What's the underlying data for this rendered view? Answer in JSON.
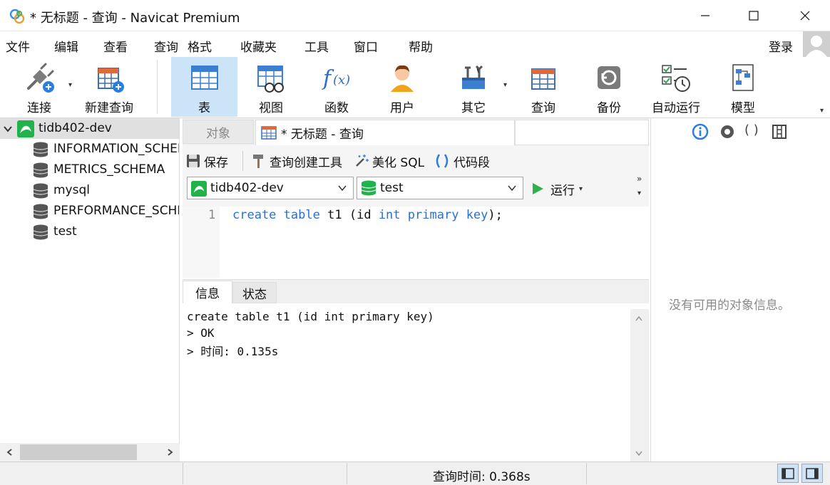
{
  "window": {
    "title": "* 无标题 - 查询 - Navicat Premium"
  },
  "menu": [
    "文件",
    "编辑",
    "查看",
    "查询",
    "格式",
    "收藏夹",
    "工具",
    "窗口",
    "帮助"
  ],
  "account": {
    "login_label": "登录"
  },
  "toolbar": {
    "connect": "连接",
    "new_query": "新建查询",
    "table": "表",
    "view": "视图",
    "function": "函数",
    "user": "用户",
    "other": "其它",
    "query": "查询",
    "backup": "备份",
    "automation": "自动运行",
    "model": "模型"
  },
  "tree": {
    "connection": "tidb402-dev",
    "databases": [
      "INFORMATION_SCHEMA",
      "METRICS_SCHEMA",
      "mysql",
      "PERFORMANCE_SCHEMA",
      "test"
    ]
  },
  "tabs": {
    "objects": "对象",
    "query": "* 无标题 - 查询"
  },
  "query_toolbar": {
    "save": "保存",
    "query_builder": "查询创建工具",
    "beautify": "美化 SQL",
    "snippet": "代码段",
    "connection_select": "tidb402-dev",
    "database_select": "test",
    "run": "运行"
  },
  "editor": {
    "line_number": "1",
    "kw1": "create",
    "kw2": "table",
    "ident": "t1",
    "open": "(id",
    "kw3": "int",
    "kw4": "primary",
    "kw5": "key",
    "close": ");"
  },
  "result_tabs": {
    "info": "信息",
    "status": "状态"
  },
  "output": [
    "create table t1 (id int primary key)",
    "> OK",
    "> 时间: 0.135s"
  ],
  "info_panel": {
    "empty_message": "没有可用的对象信息。"
  },
  "statusbar": {
    "query_time": "查询时间: 0.368s"
  },
  "colors": {
    "accent": "#2a6fd6",
    "active_tool": "#cce4f7",
    "green": "#22b24c"
  }
}
